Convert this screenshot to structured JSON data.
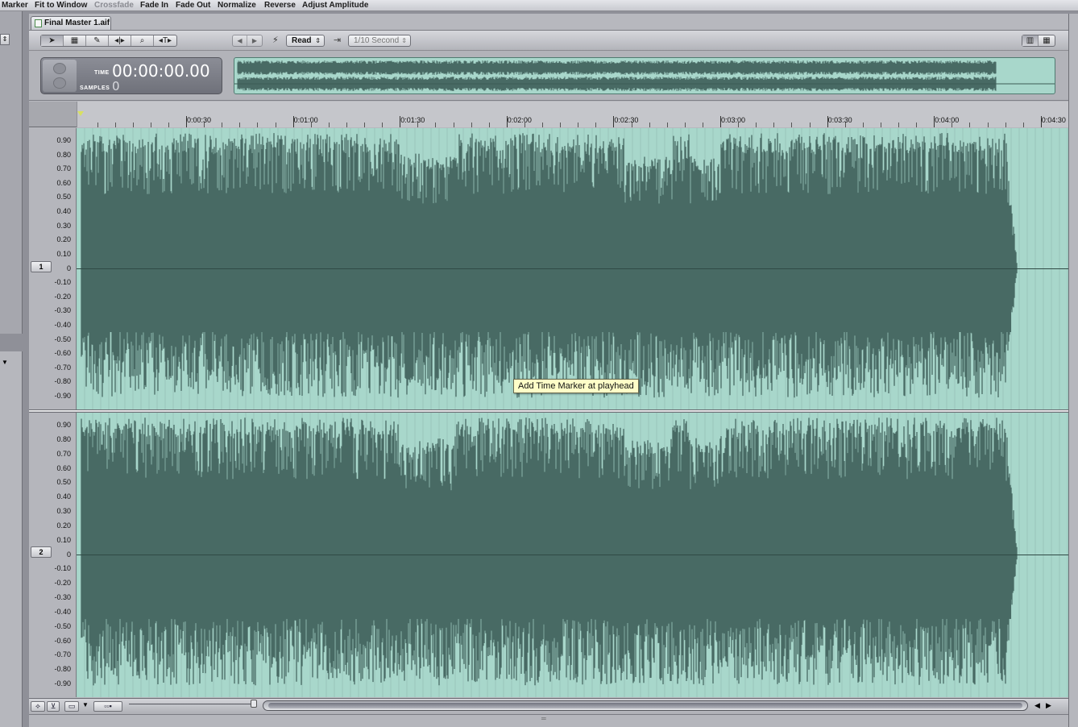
{
  "action_bar": {
    "items": [
      {
        "label": "Marker",
        "disabled": false
      },
      {
        "label": "Fit to Window",
        "disabled": false
      },
      {
        "label": "Crossfade",
        "disabled": true
      },
      {
        "label": "Fade In",
        "disabled": false
      },
      {
        "label": "Fade Out",
        "disabled": false
      },
      {
        "label": "Normalize",
        "disabled": false
      },
      {
        "label": "Reverse",
        "disabled": false
      },
      {
        "label": "Adjust Amplitude",
        "disabled": false
      }
    ]
  },
  "document": {
    "tab_title": "Final Master 1.aif"
  },
  "toolbar": {
    "tools": [
      {
        "name": "select-tool",
        "icon": "arrow-pointer-icon",
        "glyph": "➤"
      },
      {
        "name": "frequency-select-tool",
        "icon": "frequency-selection-icon",
        "glyph": "▦"
      },
      {
        "name": "pencil-tool",
        "icon": "pencil-icon",
        "glyph": "✎"
      },
      {
        "name": "scrub-tool",
        "icon": "scrub-icon",
        "glyph": "◂|▸"
      },
      {
        "name": "zoom-tool",
        "icon": "magnifier-icon",
        "glyph": "⌕"
      },
      {
        "name": "channel-tool",
        "icon": "channel-selector-icon",
        "glyph": "◂T▸"
      }
    ],
    "nav": {
      "prev_glyph": "◀",
      "next_glyph": "▶"
    },
    "automation_mode": "Read",
    "snap_value": "1/10 Second",
    "view_buttons": [
      "▥",
      "▦"
    ]
  },
  "timecode": {
    "time_label": "TIME",
    "time_value": "00:00:00.00",
    "samples_label": "SAMPLES",
    "samples_value": "0"
  },
  "ruler": {
    "ticks": [
      "0:00:30",
      "0:01:00",
      "0:01:30",
      "0:02:00",
      "0:02:30",
      "0:03:00",
      "0:03:30",
      "0:04:00",
      "0:04:30"
    ]
  },
  "tracks": [
    {
      "channel": "1"
    },
    {
      "channel": "2"
    }
  ],
  "amplitude_labels": [
    "0.90",
    "0.80",
    "0.70",
    "0.60",
    "0.50",
    "0.40",
    "0.30",
    "0.20",
    "0.10",
    "0",
    "-0.10",
    "-0.20",
    "-0.30",
    "-0.40",
    "-0.50",
    "-0.60",
    "-0.70",
    "-0.80",
    "-0.90"
  ],
  "tooltip": "Add Time Marker at playhead",
  "colors": {
    "waveform_fill": "#486a64",
    "waveform_background": "#a8d7cb",
    "empty_region": "#9a9ba6"
  }
}
